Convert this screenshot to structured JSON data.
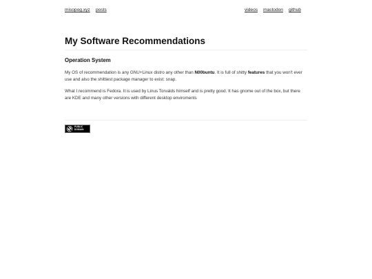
{
  "nav": {
    "home": "misopog.xyz",
    "posts": "posts",
    "videos": "videos",
    "mastodon": "mastodon",
    "github": "github"
  },
  "post": {
    "title": "My Software Recommendations",
    "section_heading": "Operation System",
    "p1": {
      "t1": "My OS of recommendation is any GNU+Linux distro any other than ",
      "b1": "N00buntu",
      "t2": ". It is full of shitty ",
      "b2": "features",
      "t3": " that you won't ever use and also the shittiest package manager to exist: snap."
    },
    "p2": "What I recommend is Fedora. It is used by Linus Torvalds himself and is pretty good. It has gnome out of the box, but there are KDE and many other versions with different desktop enviroments"
  },
  "footer": {
    "badge_line1": "PUBLIC",
    "badge_line2": "DOMAIN"
  },
  "colors": {
    "text": "#222222",
    "rule": "#eeeeee",
    "badge_bg": "#000000"
  }
}
